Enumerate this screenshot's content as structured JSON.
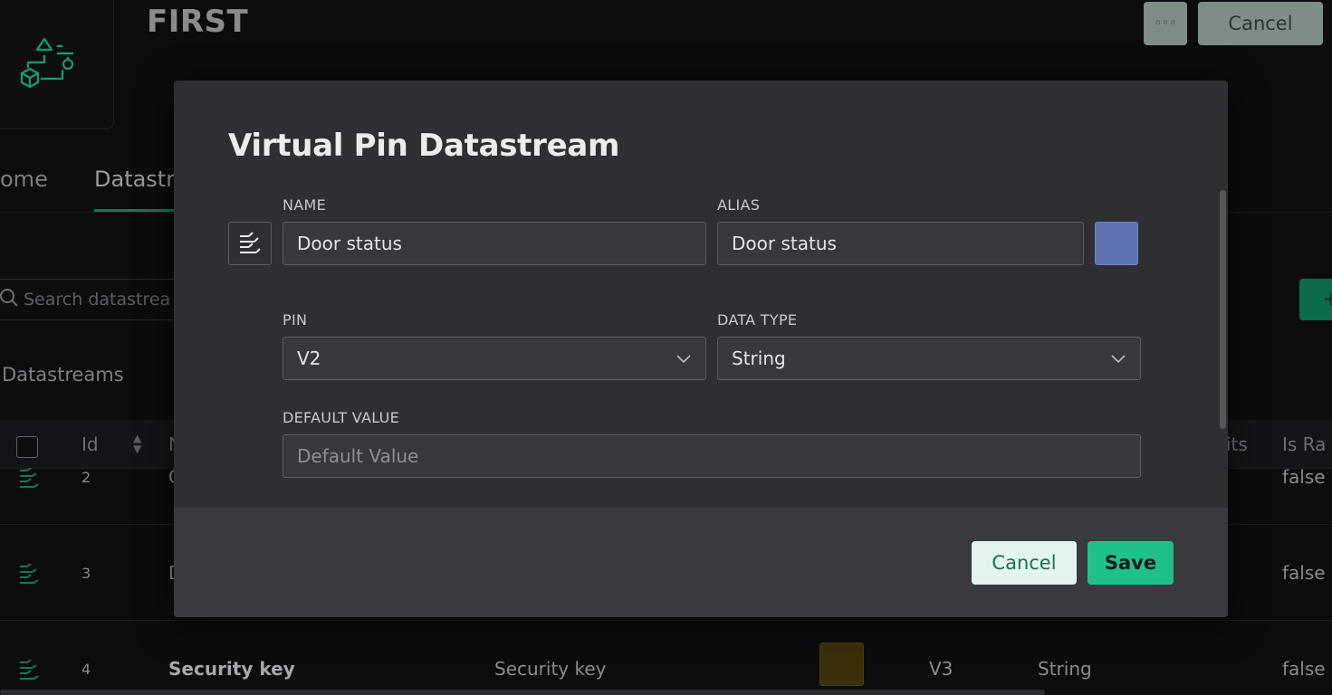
{
  "header": {
    "title": "FIRST",
    "more_label": "◦◦◦",
    "cancel_label": "Cancel"
  },
  "tabs": [
    {
      "label": "ome"
    },
    {
      "label": "Datastr"
    }
  ],
  "search": {
    "placeholder": "Search datastrea"
  },
  "add_label": "+",
  "section_title": "Datastreams",
  "table": {
    "headers": {
      "id": "Id",
      "name": "N",
      "units": "its",
      "is_raw": "Is Ra"
    },
    "rows": [
      {
        "id": "2",
        "name": "C",
        "is_raw": "false"
      },
      {
        "id": "3",
        "name": "D",
        "is_raw": "false"
      },
      {
        "id": "4",
        "name": "Security key",
        "alias": "Security key",
        "color": "#3a310a",
        "pin": "V3",
        "type": "String",
        "is_raw": "false"
      }
    ]
  },
  "modal": {
    "title": "Virtual Pin Datastream",
    "name_label": "NAME",
    "name_value": "Door status",
    "alias_label": "ALIAS",
    "alias_value": "Door status",
    "color": "#5e71b3",
    "pin_label": "PIN",
    "pin_value": "V2",
    "data_type_label": "DATA TYPE",
    "data_type_value": "String",
    "default_label": "DEFAULT VALUE",
    "default_placeholder": "Default Value",
    "cancel_label": "Cancel",
    "save_label": "Save"
  }
}
